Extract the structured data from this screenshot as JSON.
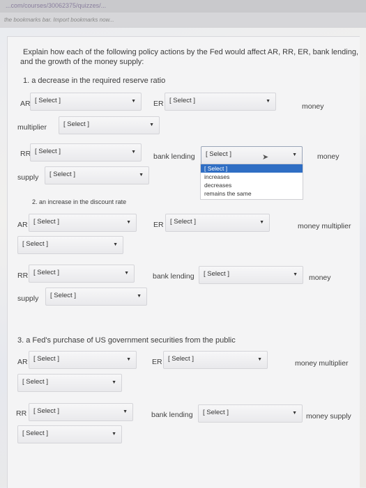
{
  "browser": {
    "url": "...com/courses/30062375/quizzes/...",
    "bookmarks_bar": "the bookmarks bar. Import bookmarks now..."
  },
  "question": {
    "prompt_line1": "Explain how each of the following policy actions by the Fed would affect AR, RR, ER, bank lending,",
    "prompt_line2": "and the growth of the money supply:"
  },
  "sections": [
    {
      "title": "1. a decrease in the required reserve ratio",
      "labels": {
        "ar": "AR",
        "er": "ER",
        "money": "money",
        "multiplier": "multiplier",
        "rr": "RR",
        "bank_lending": "bank lending",
        "money2": "money",
        "supply": "supply"
      }
    },
    {
      "title": "2. an increase in the discount rate",
      "labels": {
        "ar": "AR",
        "er": "ER",
        "money_multiplier": "money multiplier",
        "rr": "RR",
        "bank_lending": "bank lending",
        "money": "money",
        "supply": "supply"
      }
    },
    {
      "title": "3. a Fed's purchase of US government securities from the public",
      "labels": {
        "ar": "AR",
        "er": "ER",
        "money_multiplier": "money multiplier",
        "rr": "RR",
        "bank_lending": "bank lending",
        "money_supply": "money supply"
      }
    }
  ],
  "select_placeholder": "[ Select ]",
  "dropdown_open": {
    "options": [
      "[ Select ]",
      "increases",
      "decreases",
      "remains the same"
    ],
    "highlighted": "[ Select ]"
  }
}
